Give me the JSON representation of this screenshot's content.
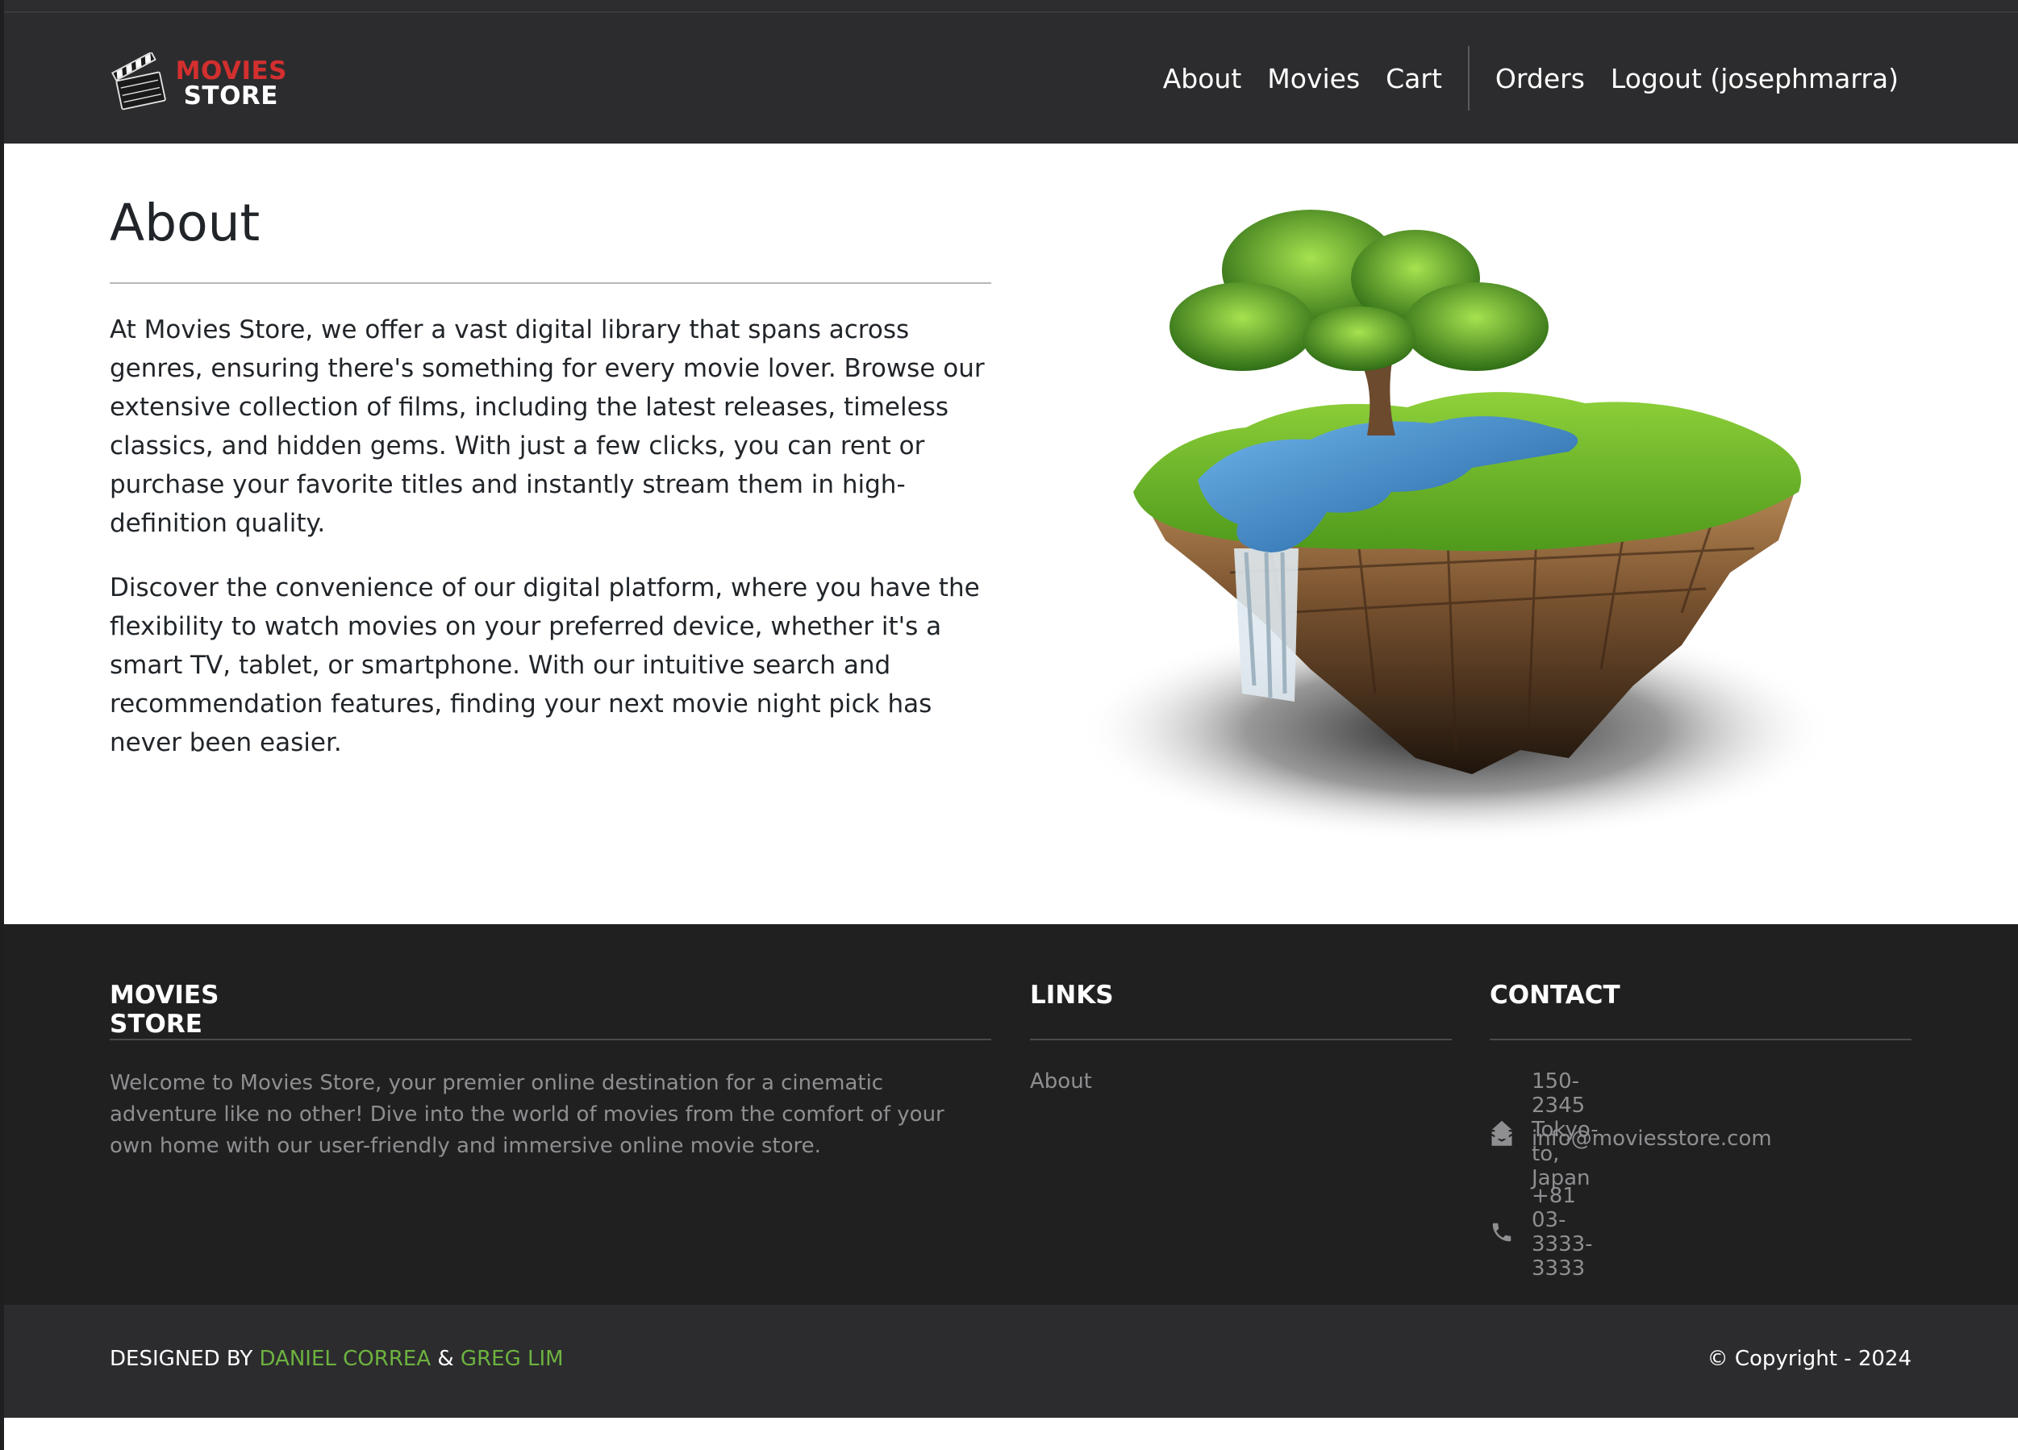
{
  "brand": {
    "line1": "MOVIES",
    "line2": "STORE",
    "logo_icon": "clapperboard-icon"
  },
  "nav": {
    "about": "About",
    "movies": "Movies",
    "cart": "Cart",
    "orders": "Orders",
    "logout": "Logout (josephmarra)"
  },
  "about": {
    "title": "About",
    "paragraphs": [
      "At Movies Store, we offer a vast digital library that spans across genres, ensuring there's something for every movie lover. Browse our extensive collection of films, including the latest releases, timeless classics, and hidden gems. With just a few clicks, you can rent or purchase your favorite titles and instantly stream them in high-definition quality.",
      "Discover the convenience of our digital platform, where you have the flexibility to watch movies on your preferred device, whether it's a smart TV, tablet, or smartphone. With our intuitive search and recommendation features, finding your next movie night pick has never been easier."
    ]
  },
  "footer": {
    "store": {
      "heading": "MOVIES STORE",
      "description": "Welcome to Movies Store, your premier online destination for a cinematic adventure like no other! Dive into the world of movies from the comfort of your own home with our user-friendly and immersive online movie store."
    },
    "links": {
      "heading": "LINKS",
      "items": [
        "About"
      ]
    },
    "contact": {
      "heading": "CONTACT",
      "address": "150-2345 Tokyo-to, Japan",
      "email": "info@moviesstore.com",
      "phone": "+81 03-3333-3333"
    },
    "bottom": {
      "designed_by": "DESIGNED BY",
      "designer1": "DANIEL CORREA",
      "and": "&",
      "designer2": "GREG LIM",
      "copyright": "© Copyright - 2024"
    }
  },
  "colors": {
    "navbar": "#2c2c2e",
    "footer": "#202021",
    "brand_red": "#d32f2f",
    "link_green": "#6db33f"
  }
}
